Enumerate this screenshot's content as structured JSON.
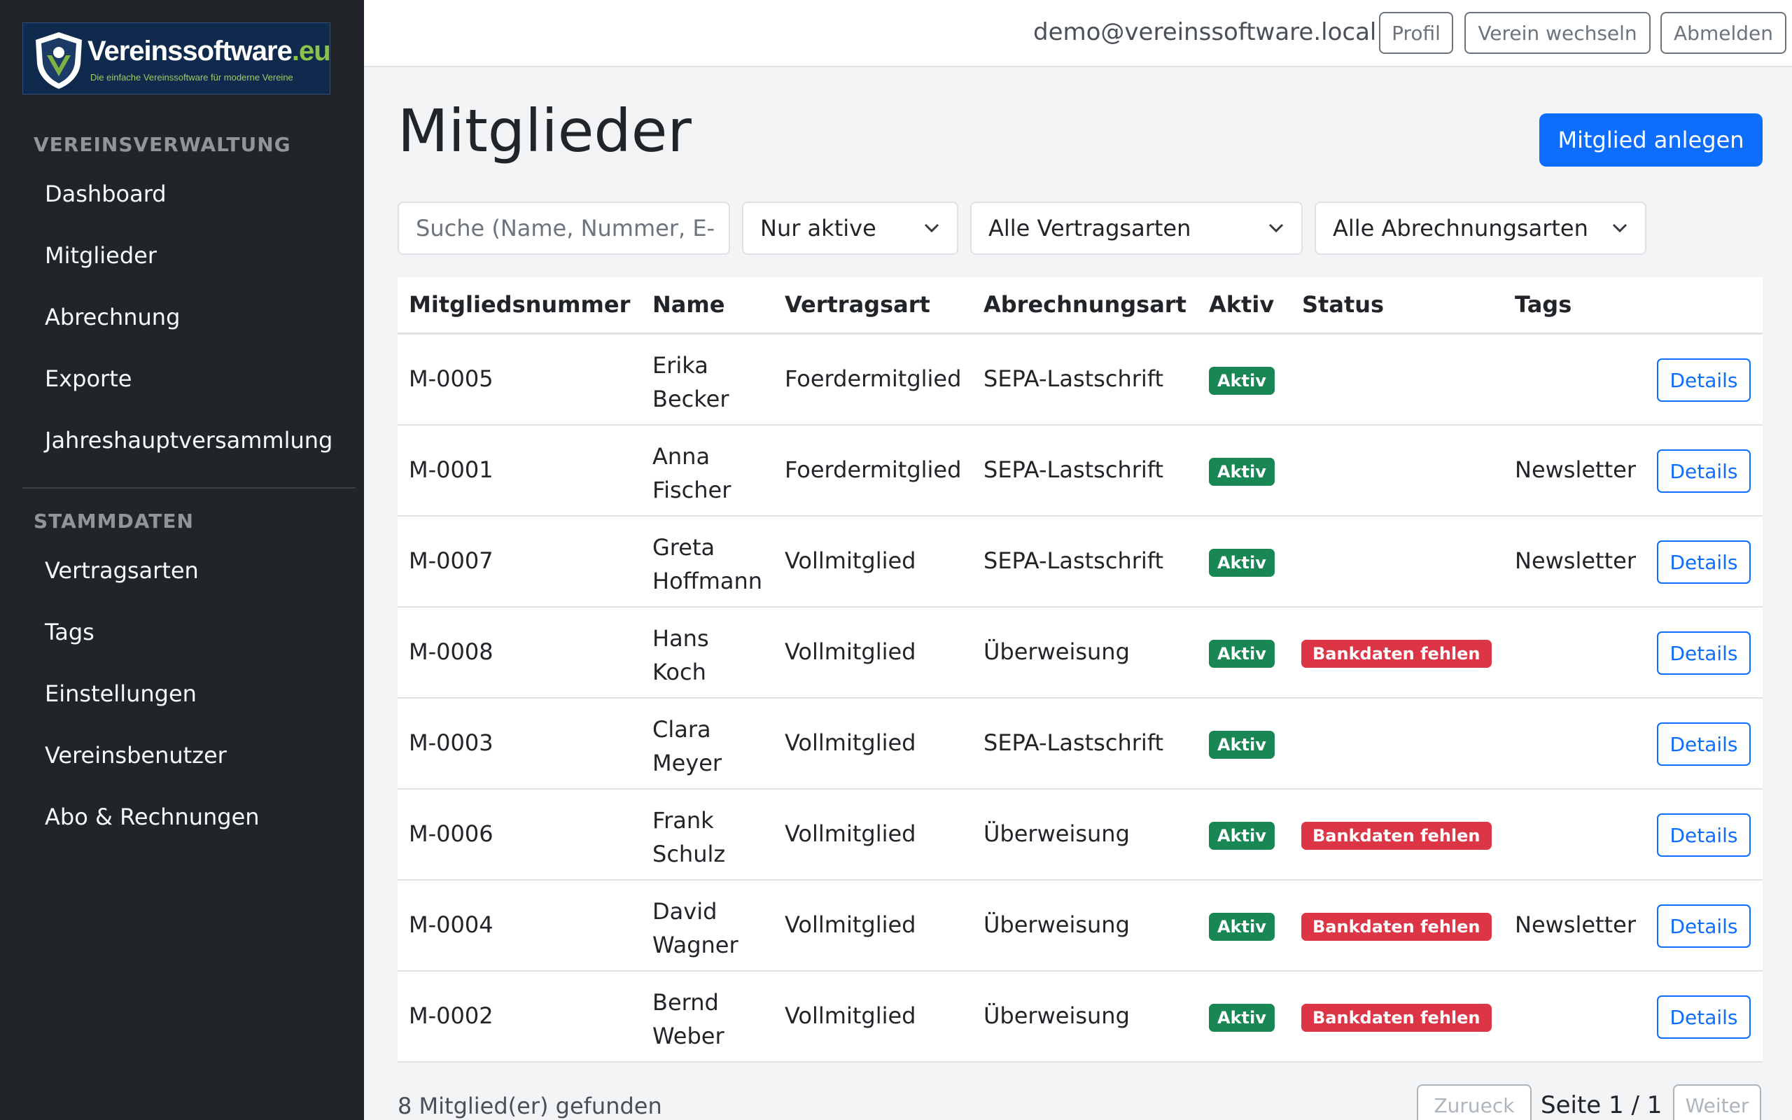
{
  "brand": {
    "name": "Vereinssoftware",
    "tld": ".eu",
    "tagline": "Die einfache Vereinssoftware für moderne Vereine"
  },
  "sidebar": {
    "sections": [
      {
        "title": "VEREINSVERWALTUNG",
        "items": [
          "Dashboard",
          "Mitglieder",
          "Abrechnung",
          "Exporte",
          "Jahreshauptversammlung"
        ]
      },
      {
        "title": "STAMMDATEN",
        "items": [
          "Vertragsarten",
          "Tags",
          "Einstellungen",
          "Vereinsbenutzer",
          "Abo & Rechnungen"
        ]
      }
    ]
  },
  "topbar": {
    "email": "demo@vereinssoftware.local",
    "profile": "Profil",
    "switch_club": "Verein wechseln",
    "logout": "Abmelden"
  },
  "page": {
    "title": "Mitglieder",
    "create_button": "Mitglied anlegen"
  },
  "filters": {
    "search_placeholder": "Suche (Name, Nummer, E-",
    "active_filter": "Nur aktive",
    "contract_filter": "Alle Vertragsarten",
    "billing_filter": "Alle Abrechnungsarten"
  },
  "table": {
    "headers": [
      "Mitgliedsnummer",
      "Name",
      "Vertragsart",
      "Abrechnungsart",
      "Aktiv",
      "Status",
      "Tags"
    ],
    "action_label": "Details",
    "rows": [
      {
        "number": "M-0005",
        "first": "Erika",
        "last": "Becker",
        "contract": "Foerdermitglied",
        "billing": "SEPA-Lastschrift",
        "active": "Aktiv",
        "status": "",
        "tags": ""
      },
      {
        "number": "M-0001",
        "first": "Anna",
        "last": "Fischer",
        "contract": "Foerdermitglied",
        "billing": "SEPA-Lastschrift",
        "active": "Aktiv",
        "status": "",
        "tags": "Newsletter"
      },
      {
        "number": "M-0007",
        "first": "Greta",
        "last": "Hoffmann",
        "contract": "Vollmitglied",
        "billing": "SEPA-Lastschrift",
        "active": "Aktiv",
        "status": "",
        "tags": "Newsletter"
      },
      {
        "number": "M-0008",
        "first": "Hans",
        "last": "Koch",
        "contract": "Vollmitglied",
        "billing": "Überweisung",
        "active": "Aktiv",
        "status": "Bankdaten fehlen",
        "tags": ""
      },
      {
        "number": "M-0003",
        "first": "Clara",
        "last": "Meyer",
        "contract": "Vollmitglied",
        "billing": "SEPA-Lastschrift",
        "active": "Aktiv",
        "status": "",
        "tags": ""
      },
      {
        "number": "M-0006",
        "first": "Frank",
        "last": "Schulz",
        "contract": "Vollmitglied",
        "billing": "Überweisung",
        "active": "Aktiv",
        "status": "Bankdaten fehlen",
        "tags": ""
      },
      {
        "number": "M-0004",
        "first": "David",
        "last": "Wagner",
        "contract": "Vollmitglied",
        "billing": "Überweisung",
        "active": "Aktiv",
        "status": "Bankdaten fehlen",
        "tags": "Newsletter"
      },
      {
        "number": "M-0002",
        "first": "Bernd",
        "last": "Weber",
        "contract": "Vollmitglied",
        "billing": "Überweisung",
        "active": "Aktiv",
        "status": "Bankdaten fehlen",
        "tags": ""
      }
    ]
  },
  "footer": {
    "count_text": "8 Mitglied(er) gefunden",
    "prev": "Zurueck",
    "page_info": "Seite 1 / 1",
    "next": "Weiter"
  },
  "colors": {
    "sidebar_bg": "#212529",
    "primary": "#0d6efd",
    "success": "#198754",
    "danger": "#dc3545"
  }
}
